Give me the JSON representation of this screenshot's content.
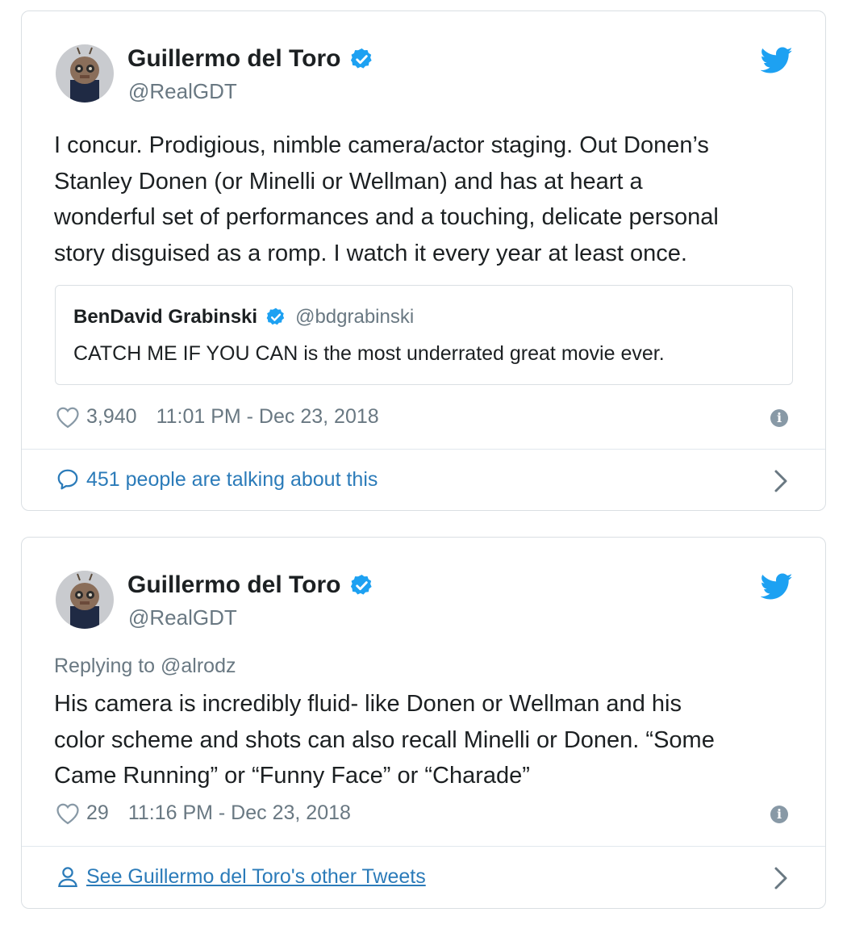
{
  "tweets": [
    {
      "author": {
        "name": "Guillermo del Toro",
        "handle": "@RealGDT"
      },
      "text_lines": [
        "I concur.  Prodigious, nimble camera/actor staging. Out Donen’s",
        "Stanley Donen (or Minelli or Wellman) and has at heart a",
        "wonderful set of performances and a touching, delicate personal",
        "story disguised as a romp. I watch it every year at least once."
      ],
      "quoted": {
        "name": "BenDavid Grabinski",
        "handle": "@bdgrabinski",
        "text": "CATCH ME IF YOU CAN is the most underrated great movie ever."
      },
      "likes": "3,940",
      "timestamp": "11:01 PM - Dec 23, 2018",
      "footer": "451 people are talking about this"
    },
    {
      "author": {
        "name": "Guillermo del Toro",
        "handle": "@RealGDT"
      },
      "replying_to": "Replying to @alrodz",
      "text_lines": [
        "His camera is incredibly fluid- like Donen or Wellman and his",
        "color scheme and shots can also recall Minelli or Donen. “Some",
        "Came Running” or “Funny Face” or “Charade”"
      ],
      "likes": "29",
      "timestamp": "11:16 PM - Dec 23, 2018",
      "footer": "See Guillermo del Toro's other Tweets"
    }
  ],
  "icons": {
    "verified": "verified-badge-icon",
    "bird": "twitter-bird-icon",
    "heart": "heart-icon",
    "info": "info-icon",
    "comment": "comment-bubble-icon",
    "person": "person-icon",
    "chevron": "chevron-right-icon"
  },
  "colors": {
    "twitter_blue": "#1da1f2",
    "link": "#2b7bb9",
    "muted": "#697882"
  },
  "info_glyph": "i"
}
